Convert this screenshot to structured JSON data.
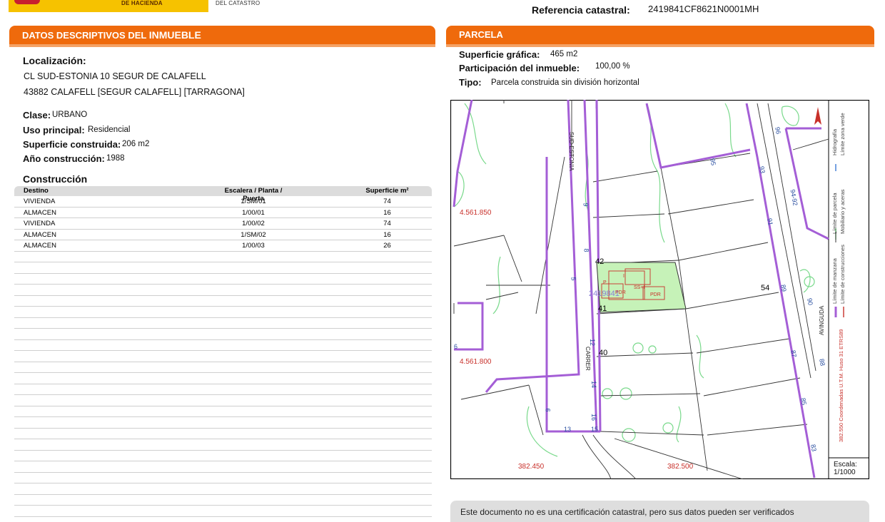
{
  "header": {
    "ministry_line": "DE HACIENDA",
    "catastro_line": "DEL CATASTRO",
    "ref_label": "Referencia catastral:",
    "ref_value": "2419841CF8621N0001MH"
  },
  "left_section": {
    "title_prefix": "DATOS DESCRIPTIVOS DEL ",
    "title_bold": "INMUEBLE",
    "localizacion_label": "Localización:",
    "address_line1": "CL SUD-ESTONIA 10 SEGUR DE CALAFELL",
    "address_line2": "43882 CALAFELL [SEGUR CALAFELL] [TARRAGONA]",
    "clase_label": "Clase:",
    "clase_value": "URBANO",
    "uso_label": "Uso principal:",
    "uso_value": "Residencial",
    "superficie_label": "Superficie construida:",
    "superficie_value": "206 m2",
    "anio_label": "Año construcción:",
    "anio_value": "1988",
    "construccion_title": "Construcción",
    "table": {
      "headers": [
        "Destino",
        "Escalera / Planta / Puerta",
        "Superficie m²"
      ],
      "rows": [
        [
          "VIVIENDA",
          "1/SM/01",
          "74"
        ],
        [
          "ALMACEN",
          "1/00/01",
          "16"
        ],
        [
          "VIVIENDA",
          "1/00/02",
          "74"
        ],
        [
          "ALMACEN",
          "1/SM/02",
          "16"
        ],
        [
          "ALMACEN",
          "1/00/03",
          "26"
        ]
      ]
    }
  },
  "right_section": {
    "title": "PARCELA",
    "sup_label": "Superficie gráfica:",
    "sup_value": "465 m2",
    "part_label": "Participación del inmueble:",
    "part_value": "100,00 %",
    "tipo_label": "Tipo:",
    "tipo_value": "Parcela construida sin división horizontal",
    "bottom_text": "Este documento no es una certificación catastral, pero sus datos pueden ser verificados"
  },
  "map": {
    "coord_y1": "4.561.850",
    "coord_y2": "4.561.800",
    "coord_x1": "382.450",
    "coord_x2": "382.500",
    "street_top": "SUD-ESTONIA",
    "street_bottom": "CARRER",
    "avinguda": "AVINGUDA",
    "block_numbers": [
      "42",
      "41",
      "40",
      "54"
    ],
    "street_numbers": [
      "96",
      "95",
      "93",
      "94-92",
      "91",
      "89",
      "90",
      "87",
      "88",
      "85",
      "83",
      "9",
      "8",
      "5",
      "12",
      "14",
      "16",
      "13",
      "15",
      "6",
      "6",
      "10",
      "9",
      "16"
    ],
    "parcel_ref": "2419841",
    "building_labels": [
      "I",
      "P",
      "PDR",
      "SS+I",
      "PDR"
    ],
    "legend": [
      "Hidrografía",
      "Límite zona verde",
      "Límite de parcela",
      "Mobiliario y aceras",
      "Límite de manzana",
      "Límite de construcciones"
    ],
    "utm": "382.550 Coordenadas U.T.M. Huso 31 ETRS89",
    "escala_label": "Escala:",
    "escala_value": "1/1000"
  },
  "colors": {
    "orange": "#ef6a0c",
    "purple": "#a45ed6",
    "green_line": "#6ad37a",
    "parcel_fill": "#c6f2b8",
    "red": "#c8302a"
  }
}
